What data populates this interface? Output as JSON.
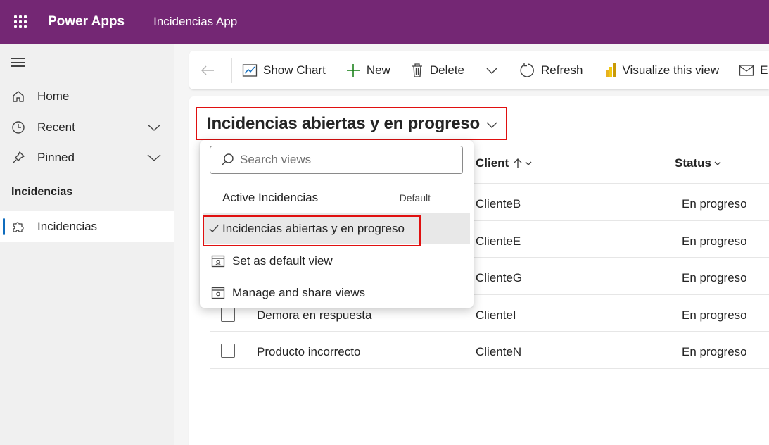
{
  "topbar": {
    "brand": "Power Apps",
    "app_name": "Incidencias App"
  },
  "sidebar": {
    "items": [
      {
        "label": "Home"
      },
      {
        "label": "Recent"
      },
      {
        "label": "Pinned"
      }
    ],
    "section_label": "Incidencias",
    "selected_item": {
      "label": "Incidencias"
    }
  },
  "commands": {
    "show_chart": "Show Chart",
    "new": "New",
    "delete": "Delete",
    "refresh": "Refresh",
    "visualize": "Visualize this view",
    "email_partial": "E"
  },
  "view": {
    "title": "Incidencias abiertas y en progreso"
  },
  "grid": {
    "columns": {
      "client": "Client",
      "status": "Status"
    },
    "rows": [
      {
        "title": "",
        "client": "ClienteB",
        "status": "En progreso"
      },
      {
        "title": "",
        "client": "ClienteE",
        "status": "En progreso"
      },
      {
        "title": "",
        "client": "ClienteG",
        "status": "En progreso"
      },
      {
        "title": "Demora en respuesta",
        "client": "ClienteI",
        "status": "En progreso"
      },
      {
        "title": "Producto incorrecto",
        "client": "ClienteN",
        "status": "En progreso"
      }
    ]
  },
  "dropdown": {
    "search_placeholder": "Search views",
    "views": [
      {
        "label": "Active Incidencias",
        "badge": "Default"
      },
      {
        "label": "Incidencias abiertas y en progreso"
      }
    ],
    "set_default": "Set as default view",
    "manage": "Manage and share views"
  },
  "colors": {
    "brand": "#742774",
    "accent": "#0f6cbd",
    "highlight": "#e01010",
    "new_plus": "#107c10"
  }
}
